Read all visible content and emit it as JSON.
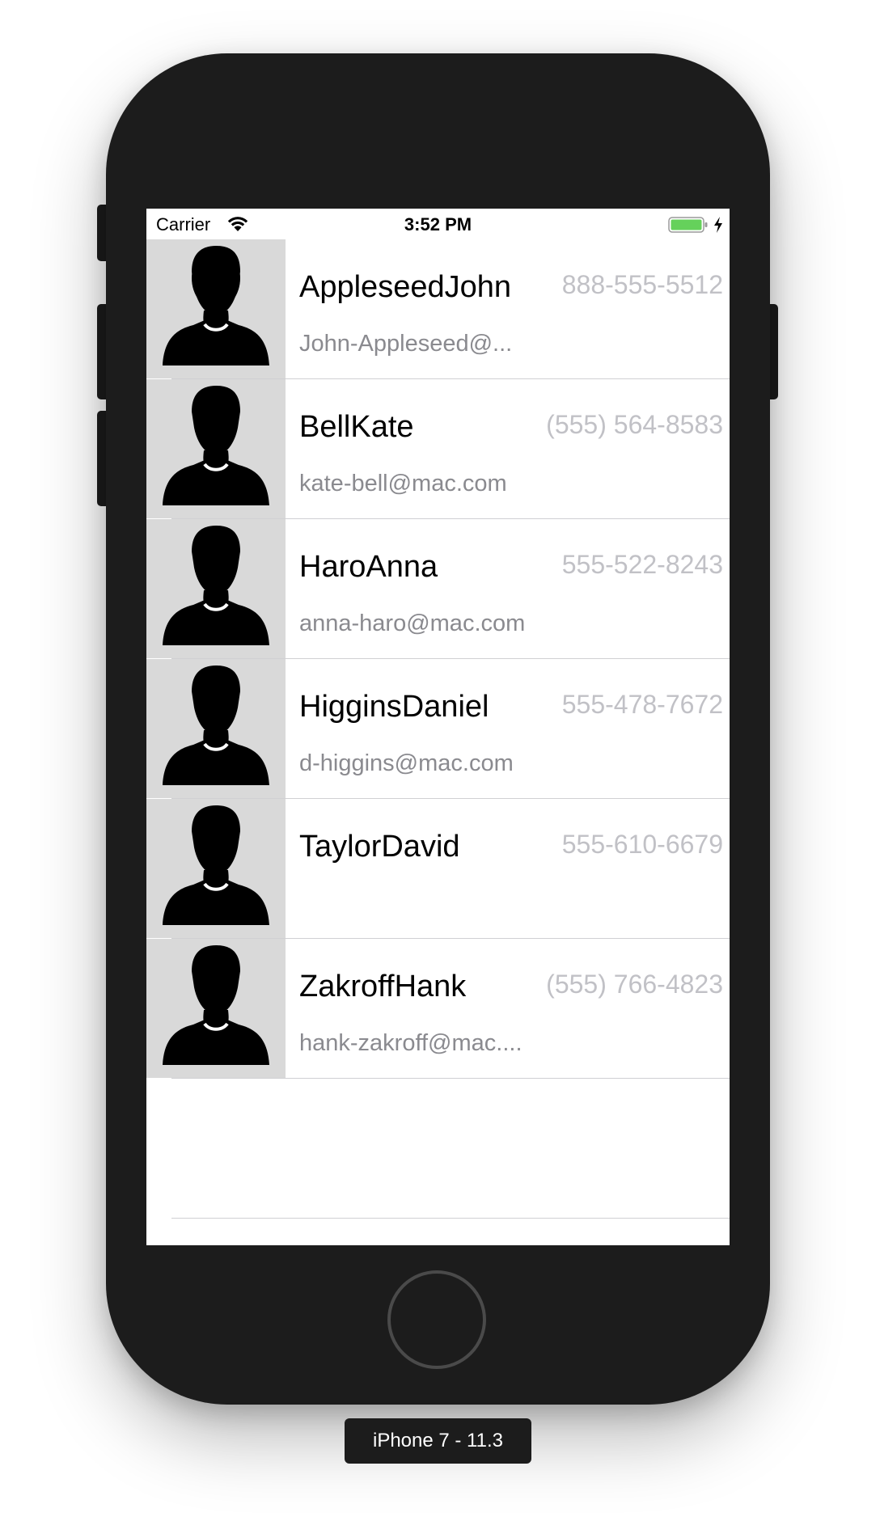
{
  "status_bar": {
    "carrier": "Carrier",
    "time": "3:52 PM",
    "battery_color": "#65d15b"
  },
  "contacts": [
    {
      "name": "AppleseedJohn",
      "phone": "888-555-5512",
      "email": "John-Appleseed@..."
    },
    {
      "name": "BellKate",
      "phone": "(555) 564-8583",
      "email": "kate-bell@mac.com"
    },
    {
      "name": "HaroAnna",
      "phone": "555-522-8243",
      "email": "anna-haro@mac.com"
    },
    {
      "name": "HigginsDaniel",
      "phone": "555-478-7672",
      "email": "d-higgins@mac.com"
    },
    {
      "name": "TaylorDavid",
      "phone": "555-610-6679",
      "email": ""
    },
    {
      "name": "ZakroffHank",
      "phone": "(555) 766-4823",
      "email": "hank-zakroff@mac...."
    }
  ],
  "device_label": "iPhone 7 - 11.3",
  "icons": {
    "avatar": "person-silhouette-icon",
    "wifi": "wifi-icon",
    "battery": "battery-icon",
    "charging": "charging-bolt-icon"
  }
}
